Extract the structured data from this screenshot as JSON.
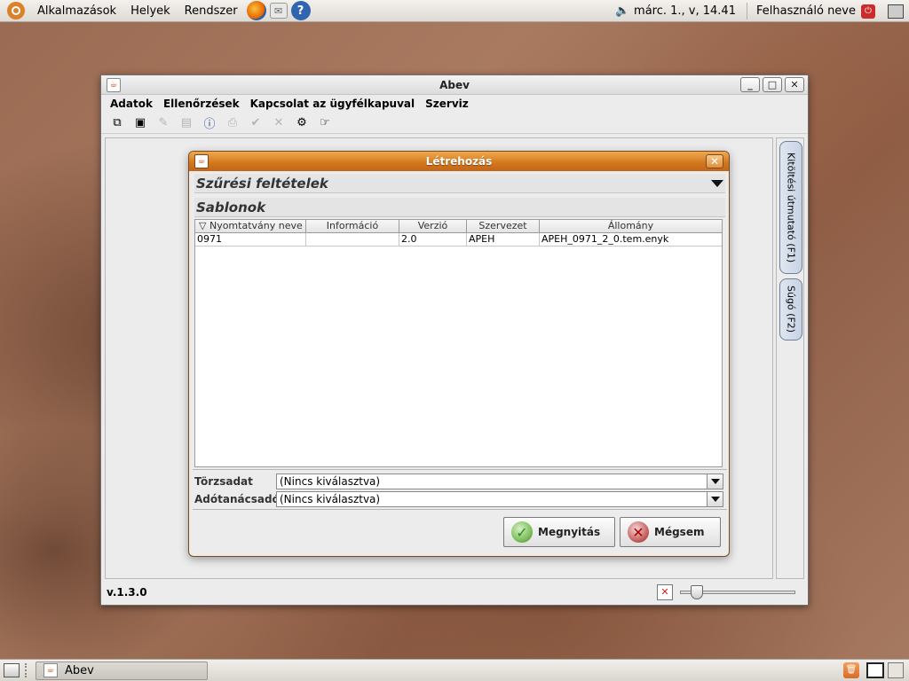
{
  "top_panel": {
    "menus": [
      "Alkalmazások",
      "Helyek",
      "Rendszer"
    ],
    "clock": "márc.  1., v, 14.41",
    "user": "Felhasználó neve"
  },
  "window": {
    "title": "Abev",
    "menu": [
      "Adatok",
      "Ellenőrzések",
      "Kapcsolat az ügyfélkapuval",
      "Szerviz"
    ],
    "side_tabs": [
      "Kitöltési útmutató (F1)",
      "Súgó (F2)"
    ],
    "version": "v.1.3.0"
  },
  "dialog": {
    "title": "Létrehozás",
    "filter_header": "Szűrési feltételek",
    "templates_header": "Sablonok",
    "columns": [
      "Nyomtatvány neve",
      "Információ",
      "Verzió",
      "Szervezet",
      "Állomány"
    ],
    "sort_indicator": "▽",
    "rows": [
      [
        "0971",
        "",
        "2.0",
        "APEH",
        "APEH_0971_2_0.tem.enyk"
      ]
    ],
    "fields": [
      {
        "label": "Törzsadat",
        "value": "(Nincs kiválasztva)"
      },
      {
        "label": "Adótanácsadó",
        "value": "(Nincs kiválasztva)"
      }
    ],
    "buttons": {
      "open": "Megnyitás",
      "cancel": "Mégsem"
    }
  },
  "taskbar": {
    "task_label": "Abev"
  },
  "icons": {
    "open": "copy-icon",
    "save": "save-icon",
    "check": "check-icon",
    "delete": "x-icon"
  },
  "colors": {
    "dialog_title": "#d2761c",
    "accent": "#3265b0"
  }
}
